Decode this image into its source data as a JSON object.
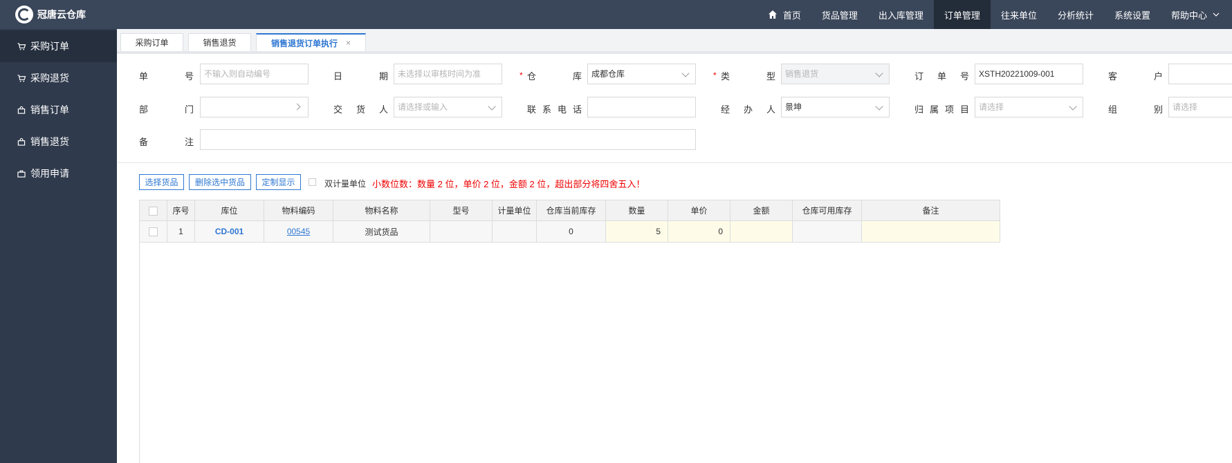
{
  "app": {
    "title": "冠唐云仓库"
  },
  "sidebar": {
    "items": [
      {
        "label": "采购订单",
        "icon": "cart-icon",
        "active": true
      },
      {
        "label": "采购退货",
        "icon": "cart-icon",
        "active": false
      },
      {
        "label": "销售订单",
        "icon": "bag-icon",
        "active": false
      },
      {
        "label": "销售退货",
        "icon": "bag-icon",
        "active": false
      },
      {
        "label": "领用申请",
        "icon": "briefcase-icon",
        "active": false
      }
    ]
  },
  "topnav": {
    "items": [
      {
        "label": "首页",
        "icon": "home-icon"
      },
      {
        "label": "货品管理"
      },
      {
        "label": "出入库管理"
      },
      {
        "label": "订单管理",
        "active": true
      },
      {
        "label": "往来单位"
      },
      {
        "label": "分析统计"
      },
      {
        "label": "系统设置"
      },
      {
        "label": "帮助中心",
        "dropdown": true
      }
    ]
  },
  "tabs": [
    {
      "label": "采购订单"
    },
    {
      "label": "销售退货"
    },
    {
      "label": "销售退货订单执行",
      "active": true,
      "close": "×"
    }
  ],
  "form": {
    "order_no": {
      "label_a": "单",
      "label_b": "号",
      "placeholder": "不输入则自动编号"
    },
    "date": {
      "label_a": "日",
      "label_b": "期",
      "placeholder": "未选择以审核时间为准"
    },
    "warehouse": {
      "label_a": "仓",
      "label_b": "库",
      "required": "*",
      "value": "成都仓库"
    },
    "type": {
      "label_a": "类",
      "label_b": "型",
      "required": "*",
      "value": "销售退货"
    },
    "ref_order": {
      "label_chars": [
        "订",
        "单",
        "号"
      ],
      "value": "XSTH20221009-001"
    },
    "customer": {
      "label_a": "客",
      "label_b": "户",
      "value": ""
    },
    "dept": {
      "label_a": "部",
      "label_b": "门",
      "value": ""
    },
    "deliverer": {
      "label_chars": [
        "交",
        "货",
        "人"
      ],
      "placeholder": "请选择或输入"
    },
    "phone": {
      "label_chars": [
        "联",
        "系",
        "电",
        "话"
      ],
      "value": ""
    },
    "handler": {
      "label_chars": [
        "经",
        "办",
        "人"
      ],
      "value": "景坤"
    },
    "project": {
      "label_chars": [
        "归",
        "属",
        "项",
        "目"
      ],
      "placeholder": "请选择"
    },
    "group": {
      "label_a": "组",
      "label_b": "别",
      "placeholder": "请选择"
    },
    "remark": {
      "label_a": "备",
      "label_b": "注",
      "value": ""
    }
  },
  "toolbar": {
    "select_goods": "选择货品",
    "delete_selected": "删除选中货品",
    "custom_display": "定制显示",
    "dual_unit": "双计量单位",
    "tip": "小数位数：数量 2 位，单价 2 位，金额 2 位，超出部分将四舍五入！"
  },
  "grid": {
    "headers": [
      "序号",
      "库位",
      "物料编码",
      "物料名称",
      "型号",
      "计量单位",
      "仓库当前库存",
      "数量",
      "单价",
      "金额",
      "仓库可用库存",
      "备注"
    ],
    "rows": [
      {
        "seq": "1",
        "location": "CD-001",
        "code": "00545",
        "name": "测试货品",
        "model": "",
        "unit": "",
        "stock": "0",
        "qty": "5",
        "price": "0",
        "amount": "",
        "available": "",
        "remark": ""
      }
    ]
  }
}
